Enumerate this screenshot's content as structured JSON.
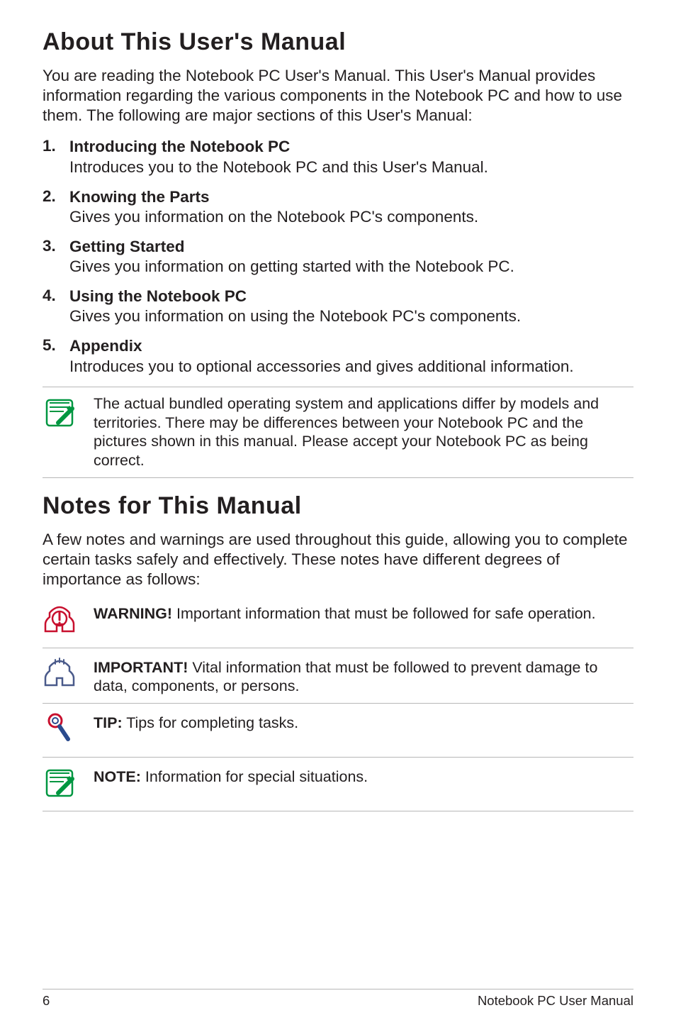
{
  "section1": {
    "heading": "About This User's Manual",
    "intro": "You are reading the Notebook PC User's Manual. This User's Manual provides information regarding the various components in the Notebook PC and how to use them. The following are major sections of this User's Manual:",
    "items": [
      {
        "num": "1.",
        "title": "Introducing the Notebook PC",
        "desc": "Introduces you to the Notebook PC and this User's Manual."
      },
      {
        "num": "2.",
        "title": "Knowing the Parts",
        "desc": "Gives you information on the Notebook PC's components."
      },
      {
        "num": "3.",
        "title": "Getting Started",
        "desc": "Gives you information on getting started with the Notebook PC."
      },
      {
        "num": "4.",
        "title": "Using the Notebook PC",
        "desc": "Gives you information on using the Notebook PC's components."
      },
      {
        "num": "5.",
        "title": "Appendix",
        "desc": "Introduces you to optional accessories and gives additional information."
      }
    ],
    "note": "The actual bundled operating system and applications differ by models and territories. There may be differences between your Notebook PC and the pictures shown in this manual. Please accept your Notebook PC as being correct."
  },
  "section2": {
    "heading": "Notes for This Manual",
    "intro": "A few notes and warnings are used throughout this guide, allowing you to complete certain tasks safely and effectively. These notes have different degrees of importance as follows:",
    "notes": [
      {
        "lead": "WARNING!",
        "text": " Important information that must be followed for safe operation."
      },
      {
        "lead": "IMPORTANT!",
        "text": " Vital information that must be followed to prevent damage to data, components, or persons."
      },
      {
        "lead": "TIP:",
        "text": " Tips for completing tasks."
      },
      {
        "lead": "NOTE:",
        "text": "  Information for special situations."
      }
    ]
  },
  "footer": {
    "page": "6",
    "title": "Notebook PC User Manual"
  }
}
